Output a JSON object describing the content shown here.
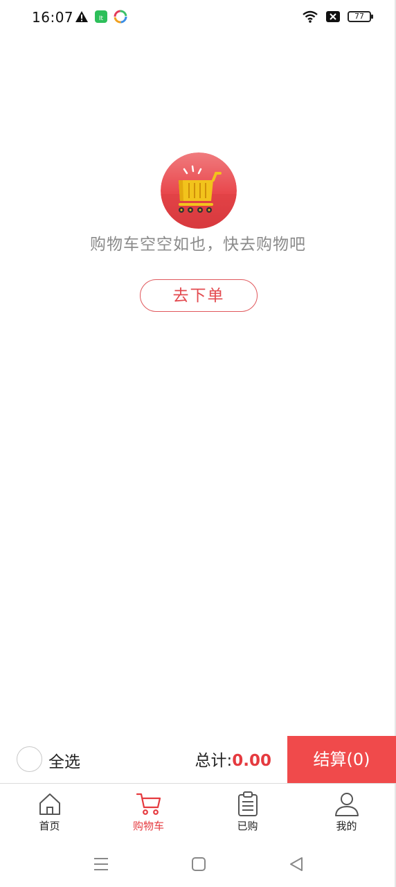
{
  "status_bar": {
    "time": "16:07",
    "battery": "77",
    "icons": [
      "warning-icon",
      "green-app-icon",
      "colorful-app-icon",
      "wifi-icon",
      "no-signal-icon",
      "battery-icon"
    ]
  },
  "empty_state": {
    "message": "购物车空空如也，快去购物吧",
    "button_label": "去下单",
    "image_icon": "shopping-cart-icon"
  },
  "checkout": {
    "select_all_label": "全选",
    "total_label": "总计:",
    "total_amount": "0.00",
    "checkout_label": "结算(0)"
  },
  "tabs": [
    {
      "label": "首页",
      "icon": "home-icon",
      "active": false
    },
    {
      "label": "购物车",
      "icon": "cart-icon",
      "active": true
    },
    {
      "label": "已购",
      "icon": "clipboard-icon",
      "active": false
    },
    {
      "label": "我的",
      "icon": "user-icon",
      "active": false
    }
  ],
  "colors": {
    "accent": "#e53a3f",
    "checkout_bg": "#f04a4b",
    "muted_text": "#8a8a8a"
  }
}
